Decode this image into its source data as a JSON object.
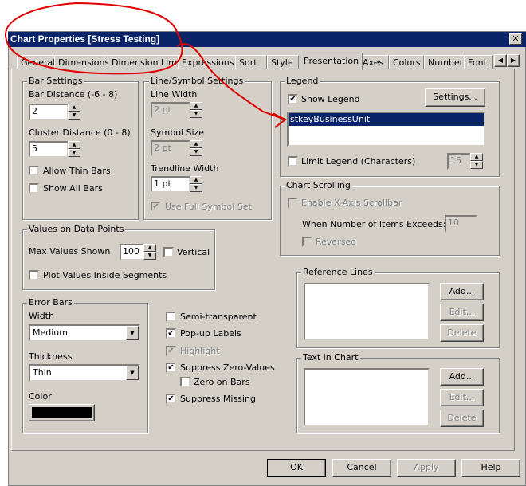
{
  "window": {
    "title": "Chart Properties [Stress Testing]",
    "close": "✕"
  },
  "tabs": [
    "General",
    "Dimensions",
    "Dimension Limits",
    "Expressions",
    "Sort",
    "Style",
    "Presentation",
    "Axes",
    "Colors",
    "Number",
    "Font"
  ],
  "active_tab": "Presentation",
  "tab_scroll": {
    "left": "◀",
    "right": "▶"
  },
  "bar_settings": {
    "title": "Bar Settings",
    "bar_distance_label": "Bar Distance (-6 - 8)",
    "bar_distance": "2",
    "cluster_distance_label": "Cluster Distance (0 - 8)",
    "cluster_distance": "5",
    "allow_thin_bars": "Allow Thin Bars",
    "show_all_bars": "Show All Bars"
  },
  "line_symbol": {
    "title": "Line/Symbol Settings",
    "line_width_label": "Line Width",
    "line_width": "2 pt",
    "symbol_size_label": "Symbol Size",
    "symbol_size": "2 pt",
    "trendline_width_label": "Trendline Width",
    "trendline_width": "1 pt",
    "use_full_symbol_set": "Use Full Symbol Set"
  },
  "legend": {
    "title": "Legend",
    "show_legend": "Show Legend",
    "settings": "Settings...",
    "items": [
      "stkeyBusinessUnit"
    ],
    "limit_legend": "Limit Legend (Characters)",
    "limit_value": "15"
  },
  "chart_scrolling": {
    "title": "Chart Scrolling",
    "enable_scrollbar": "Enable X-Axis Scrollbar",
    "when_exceeds": "When Number of Items Exceeds:",
    "exceeds_value": "10",
    "reversed": "Reversed"
  },
  "values_on_points": {
    "title": "Values on Data Points",
    "max_values_label": "Max Values Shown",
    "max_values": "100",
    "vertical": "Vertical",
    "plot_inside": "Plot Values Inside Segments"
  },
  "error_bars": {
    "title": "Error Bars",
    "width_label": "Width",
    "width": "Medium",
    "thickness_label": "Thickness",
    "thickness": "Thin",
    "color_label": "Color",
    "color": "#000000"
  },
  "options": {
    "semi_transparent": "Semi-transparent",
    "popup_labels": "Pop-up Labels",
    "highlight": "Highlight",
    "suppress_zero": "Suppress Zero-Values",
    "zero_on_bars": "Zero on Bars",
    "suppress_missing": "Suppress Missing"
  },
  "reference_lines": {
    "title": "Reference Lines",
    "add": "Add...",
    "edit": "Edit...",
    "delete": "Delete"
  },
  "text_in_chart": {
    "title": "Text in Chart",
    "add": "Add...",
    "edit": "Edit...",
    "delete": "Delete"
  },
  "footer": {
    "ok": "OK",
    "cancel": "Cancel",
    "apply": "Apply",
    "help": "Help"
  },
  "check": "✔",
  "colors": {
    "titlebar": "#0a246a",
    "dialog": "#d4d0c8",
    "selection": "#0a246a",
    "annotation": "#e00000"
  }
}
